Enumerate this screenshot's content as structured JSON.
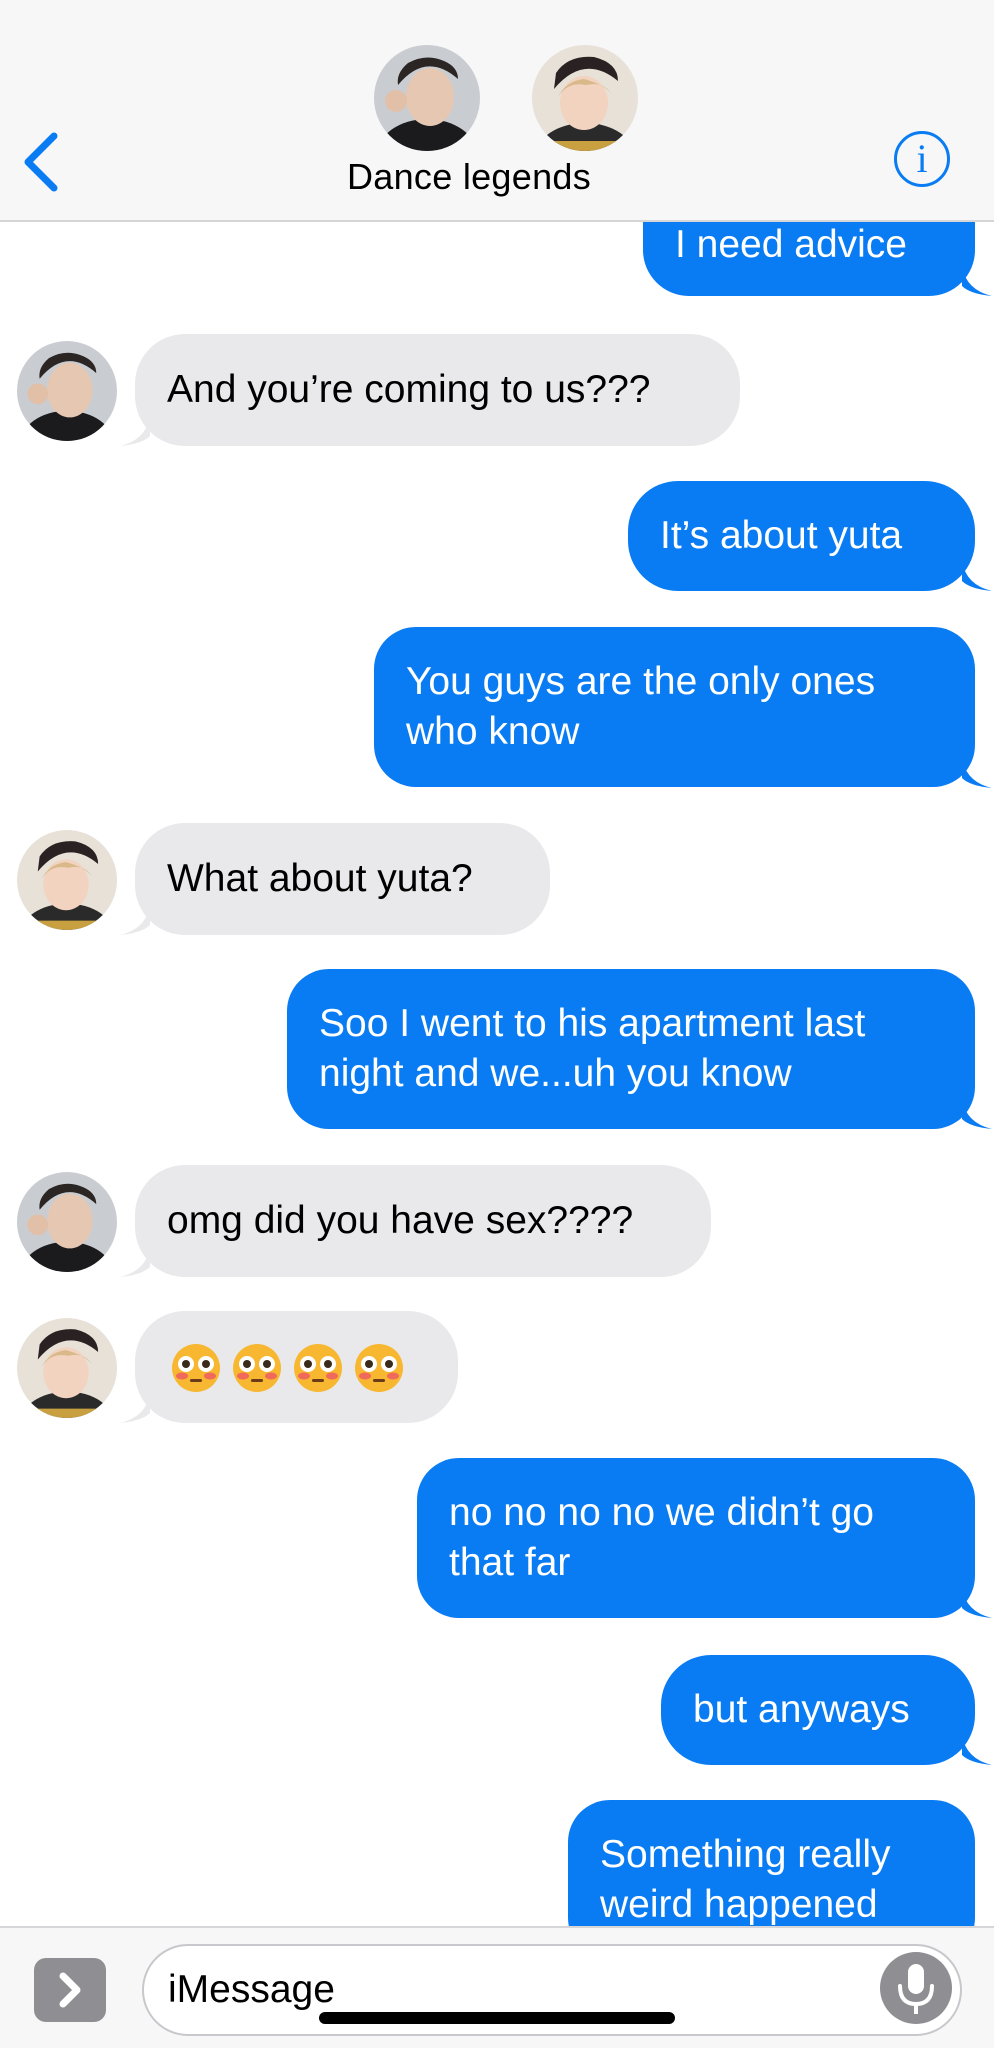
{
  "header": {
    "title": "Dance legends"
  },
  "messages": [
    {
      "side": "out",
      "text": "I need advice"
    },
    {
      "side": "in",
      "sender": "member1",
      "text": "And you’re coming to us???"
    },
    {
      "side": "out",
      "text": "It’s about yuta"
    },
    {
      "side": "out",
      "lines": [
        "You guys are the only ones",
        "who know"
      ]
    },
    {
      "side": "in",
      "sender": "member2",
      "text": "What about yuta?"
    },
    {
      "side": "out",
      "lines": [
        "Soo I went to his apartment last",
        "night and we...uh you know"
      ]
    },
    {
      "side": "in",
      "sender": "member1",
      "text": "omg did you have sex????"
    },
    {
      "side": "in",
      "sender": "member2",
      "emoji_count": 4,
      "emoji": "flushed-face"
    },
    {
      "side": "out",
      "lines": [
        "no no no no we didn’t go",
        "that far"
      ]
    },
    {
      "side": "out",
      "text": "but anyways"
    },
    {
      "side": "out",
      "lines": [
        "Something really",
        "weird happened"
      ]
    }
  ],
  "input": {
    "placeholder": "iMessage"
  },
  "colors": {
    "outgoing": "#0a7cf3",
    "incoming": "#e9e9eb",
    "accent": "#0a7cf3"
  },
  "icons": {
    "back": "chevron-left-icon",
    "info": "info-icon",
    "apps": "chevron-right-icon",
    "mic": "microphone-icon"
  }
}
